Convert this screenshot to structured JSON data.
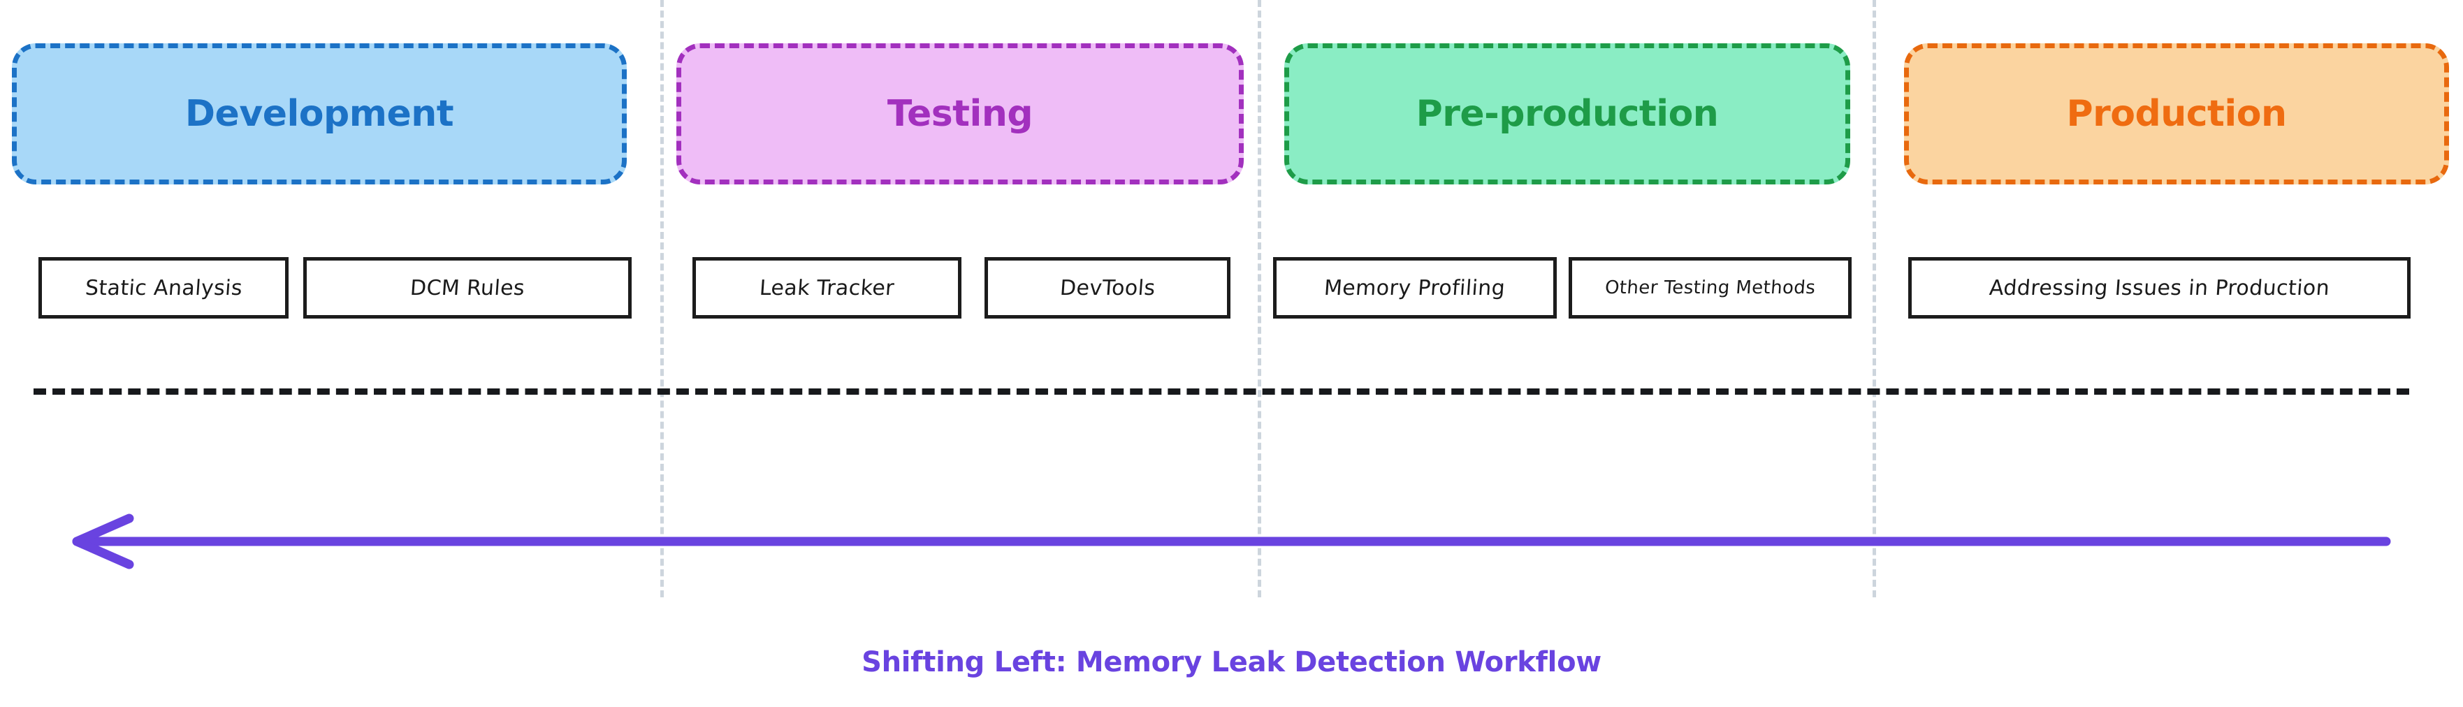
{
  "diagram": {
    "caption": "Shifting Left: Memory Leak Detection Workflow",
    "caption_color": "#6943E0",
    "arrow": {
      "name": "shift-left-arrow",
      "direction": "left",
      "color": "#6943E0"
    },
    "baseline": {
      "name": "timeline-dashed-rule",
      "color": "#17191c"
    },
    "divider_color": "#cdd5dd",
    "stages": [
      {
        "label": "Development",
        "fill": "#A8D8F8",
        "stroke": "#1C72C6",
        "text_color": "#1C72C6",
        "tools": [
          {
            "label": "Static Analysis"
          },
          {
            "label": "DCM Rules"
          }
        ]
      },
      {
        "label": "Testing",
        "fill": "#EFBDF7",
        "stroke": "#A230BE",
        "text_color": "#A230BE",
        "tools": [
          {
            "label": "Leak Tracker"
          },
          {
            "label": "DevTools"
          }
        ]
      },
      {
        "label": "Pre-production",
        "fill": "#8AEDC4",
        "stroke": "#1E9C48",
        "text_color": "#1E9C48",
        "tools": [
          {
            "label": "Memory Profiling"
          },
          {
            "label": "Other Testing Methods"
          }
        ]
      },
      {
        "label": "Production",
        "fill": "#FBD4A0",
        "stroke": "#E8690E",
        "text_color": "#EF6C11",
        "tools": [
          {
            "label": "Addressing Issues in Production"
          }
        ]
      }
    ]
  }
}
